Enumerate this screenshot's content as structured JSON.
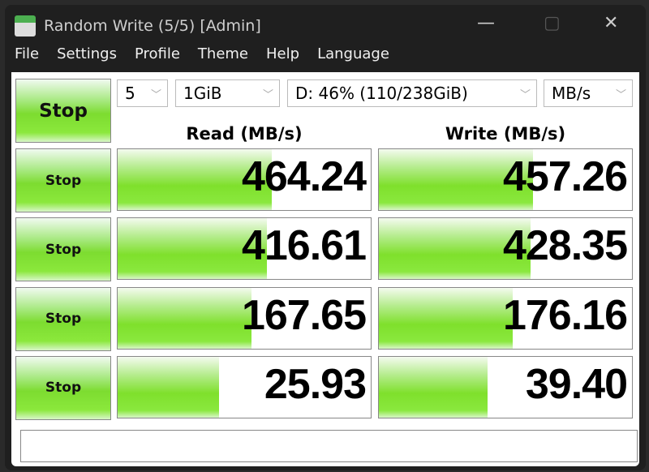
{
  "window": {
    "title": "Random Write (5/5) [Admin]",
    "minimize": "—",
    "maximize": "▢",
    "close": "✕"
  },
  "menu": [
    "File",
    "Settings",
    "Profile",
    "Theme",
    "Help",
    "Language"
  ],
  "controls": {
    "all_button": "Stop",
    "count": "5",
    "size": "1GiB",
    "drive": "D: 46% (110/238GiB)",
    "unit": "MB/s"
  },
  "headers": {
    "read": "Read (MB/s)",
    "write": "Write (MB/s)"
  },
  "rows": [
    {
      "button": "Stop",
      "read": "464.24",
      "write": "457.26",
      "read_fill": 0.61,
      "write_fill": 0.61
    },
    {
      "button": "Stop",
      "read": "416.61",
      "write": "428.35",
      "read_fill": 0.59,
      "write_fill": 0.6
    },
    {
      "button": "Stop",
      "read": "167.65",
      "write": "176.16",
      "read_fill": 0.53,
      "write_fill": 0.53
    },
    {
      "button": "Stop",
      "read": "25.93",
      "write": "39.40",
      "read_fill": 0.4,
      "write_fill": 0.43
    }
  ],
  "status": "",
  "colors": {
    "accent": "#7fe02c"
  }
}
